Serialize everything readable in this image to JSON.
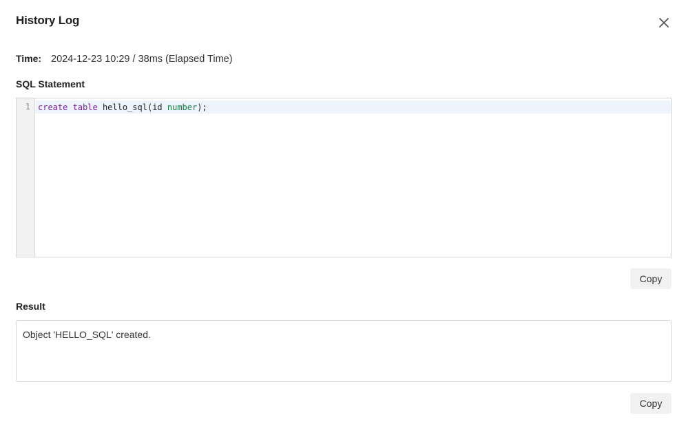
{
  "dialog": {
    "title": "History Log",
    "close_icon": "close-icon"
  },
  "time": {
    "label": "Time:",
    "value": "2024-12-23 10:29 / 38ms (Elapsed Time)"
  },
  "sql": {
    "label": "SQL Statement",
    "lines": [
      {
        "number": "1",
        "tokens": [
          {
            "text": "create",
            "kind": "keyword"
          },
          {
            "text": " ",
            "kind": "plain"
          },
          {
            "text": "table",
            "kind": "keyword"
          },
          {
            "text": " hello_sql(id ",
            "kind": "plain"
          },
          {
            "text": "number",
            "kind": "type"
          },
          {
            "text": ");",
            "kind": "plain"
          }
        ]
      }
    ],
    "copy_label": "Copy"
  },
  "result": {
    "label": "Result",
    "text": "Object 'HELLO_SQL' created.",
    "copy_label": "Copy"
  },
  "colors": {
    "keyword": "#7a1fa2",
    "type": "#15803d",
    "active_line": "#eef4fb"
  }
}
